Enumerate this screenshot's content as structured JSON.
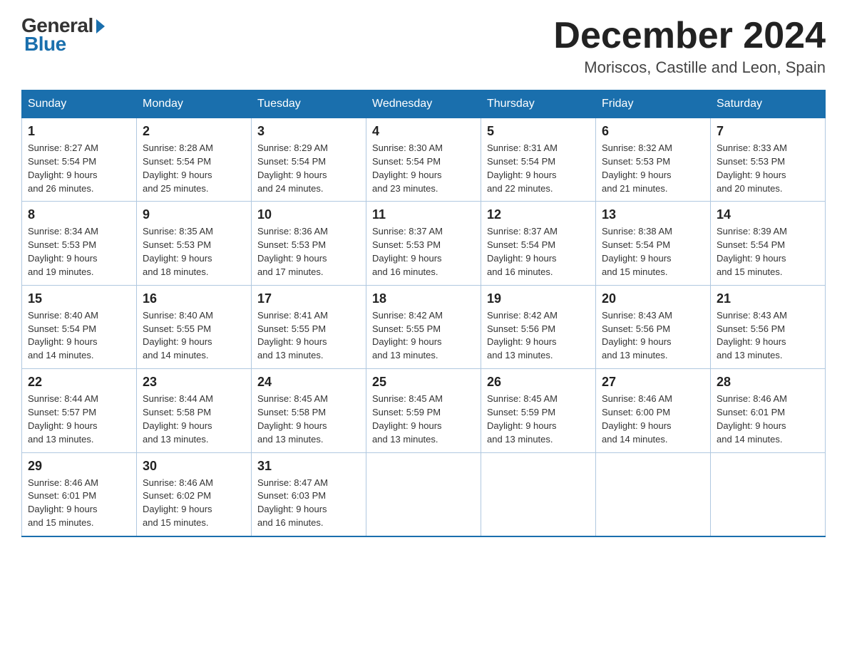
{
  "logo": {
    "general": "General",
    "blue": "Blue"
  },
  "header": {
    "month": "December 2024",
    "location": "Moriscos, Castille and Leon, Spain"
  },
  "days_of_week": [
    "Sunday",
    "Monday",
    "Tuesday",
    "Wednesday",
    "Thursday",
    "Friday",
    "Saturday"
  ],
  "weeks": [
    [
      {
        "num": "1",
        "sunrise": "8:27 AM",
        "sunset": "5:54 PM",
        "daylight": "9 hours and 26 minutes."
      },
      {
        "num": "2",
        "sunrise": "8:28 AM",
        "sunset": "5:54 PM",
        "daylight": "9 hours and 25 minutes."
      },
      {
        "num": "3",
        "sunrise": "8:29 AM",
        "sunset": "5:54 PM",
        "daylight": "9 hours and 24 minutes."
      },
      {
        "num": "4",
        "sunrise": "8:30 AM",
        "sunset": "5:54 PM",
        "daylight": "9 hours and 23 minutes."
      },
      {
        "num": "5",
        "sunrise": "8:31 AM",
        "sunset": "5:54 PM",
        "daylight": "9 hours and 22 minutes."
      },
      {
        "num": "6",
        "sunrise": "8:32 AM",
        "sunset": "5:53 PM",
        "daylight": "9 hours and 21 minutes."
      },
      {
        "num": "7",
        "sunrise": "8:33 AM",
        "sunset": "5:53 PM",
        "daylight": "9 hours and 20 minutes."
      }
    ],
    [
      {
        "num": "8",
        "sunrise": "8:34 AM",
        "sunset": "5:53 PM",
        "daylight": "9 hours and 19 minutes."
      },
      {
        "num": "9",
        "sunrise": "8:35 AM",
        "sunset": "5:53 PM",
        "daylight": "9 hours and 18 minutes."
      },
      {
        "num": "10",
        "sunrise": "8:36 AM",
        "sunset": "5:53 PM",
        "daylight": "9 hours and 17 minutes."
      },
      {
        "num": "11",
        "sunrise": "8:37 AM",
        "sunset": "5:53 PM",
        "daylight": "9 hours and 16 minutes."
      },
      {
        "num": "12",
        "sunrise": "8:37 AM",
        "sunset": "5:54 PM",
        "daylight": "9 hours and 16 minutes."
      },
      {
        "num": "13",
        "sunrise": "8:38 AM",
        "sunset": "5:54 PM",
        "daylight": "9 hours and 15 minutes."
      },
      {
        "num": "14",
        "sunrise": "8:39 AM",
        "sunset": "5:54 PM",
        "daylight": "9 hours and 15 minutes."
      }
    ],
    [
      {
        "num": "15",
        "sunrise": "8:40 AM",
        "sunset": "5:54 PM",
        "daylight": "9 hours and 14 minutes."
      },
      {
        "num": "16",
        "sunrise": "8:40 AM",
        "sunset": "5:55 PM",
        "daylight": "9 hours and 14 minutes."
      },
      {
        "num": "17",
        "sunrise": "8:41 AM",
        "sunset": "5:55 PM",
        "daylight": "9 hours and 13 minutes."
      },
      {
        "num": "18",
        "sunrise": "8:42 AM",
        "sunset": "5:55 PM",
        "daylight": "9 hours and 13 minutes."
      },
      {
        "num": "19",
        "sunrise": "8:42 AM",
        "sunset": "5:56 PM",
        "daylight": "9 hours and 13 minutes."
      },
      {
        "num": "20",
        "sunrise": "8:43 AM",
        "sunset": "5:56 PM",
        "daylight": "9 hours and 13 minutes."
      },
      {
        "num": "21",
        "sunrise": "8:43 AM",
        "sunset": "5:56 PM",
        "daylight": "9 hours and 13 minutes."
      }
    ],
    [
      {
        "num": "22",
        "sunrise": "8:44 AM",
        "sunset": "5:57 PM",
        "daylight": "9 hours and 13 minutes."
      },
      {
        "num": "23",
        "sunrise": "8:44 AM",
        "sunset": "5:58 PM",
        "daylight": "9 hours and 13 minutes."
      },
      {
        "num": "24",
        "sunrise": "8:45 AM",
        "sunset": "5:58 PM",
        "daylight": "9 hours and 13 minutes."
      },
      {
        "num": "25",
        "sunrise": "8:45 AM",
        "sunset": "5:59 PM",
        "daylight": "9 hours and 13 minutes."
      },
      {
        "num": "26",
        "sunrise": "8:45 AM",
        "sunset": "5:59 PM",
        "daylight": "9 hours and 13 minutes."
      },
      {
        "num": "27",
        "sunrise": "8:46 AM",
        "sunset": "6:00 PM",
        "daylight": "9 hours and 14 minutes."
      },
      {
        "num": "28",
        "sunrise": "8:46 AM",
        "sunset": "6:01 PM",
        "daylight": "9 hours and 14 minutes."
      }
    ],
    [
      {
        "num": "29",
        "sunrise": "8:46 AM",
        "sunset": "6:01 PM",
        "daylight": "9 hours and 15 minutes."
      },
      {
        "num": "30",
        "sunrise": "8:46 AM",
        "sunset": "6:02 PM",
        "daylight": "9 hours and 15 minutes."
      },
      {
        "num": "31",
        "sunrise": "8:47 AM",
        "sunset": "6:03 PM",
        "daylight": "9 hours and 16 minutes."
      },
      null,
      null,
      null,
      null
    ]
  ]
}
